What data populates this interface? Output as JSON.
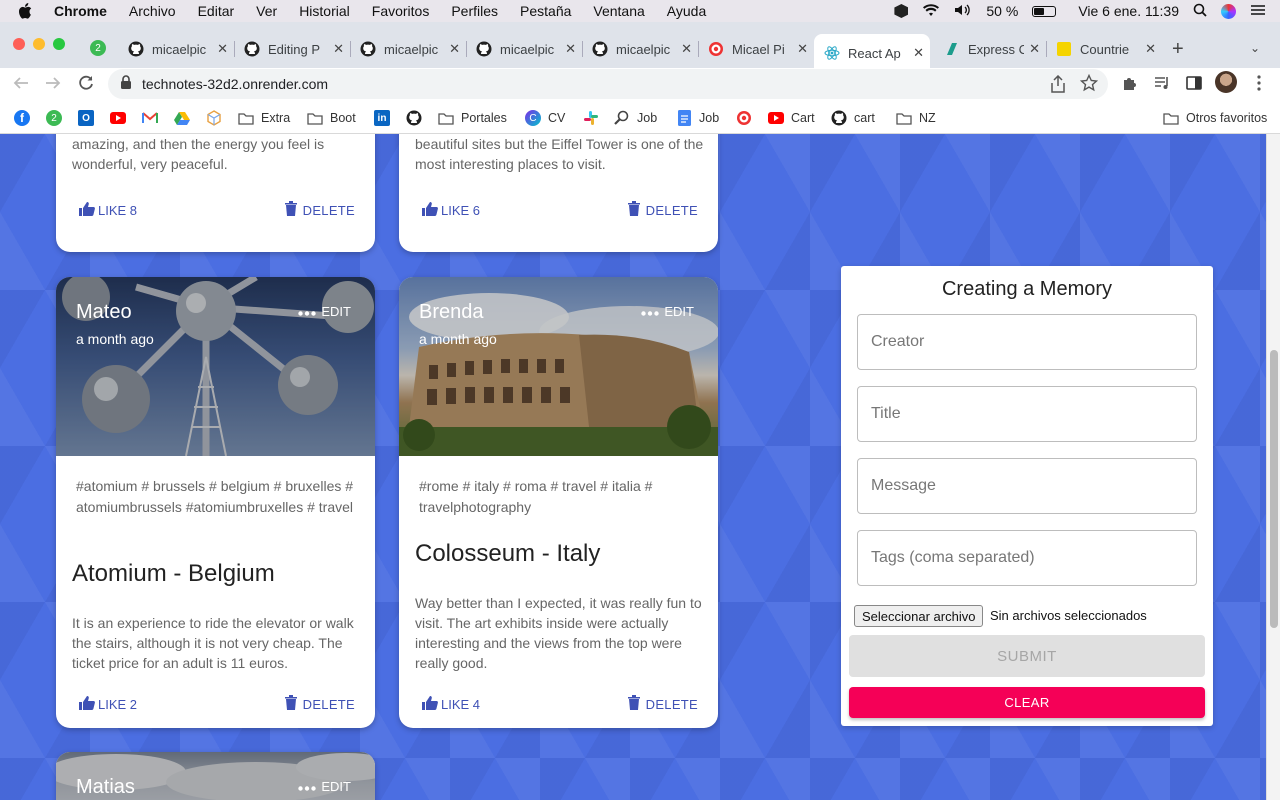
{
  "menubar": {
    "app": "Chrome",
    "items": [
      "Archivo",
      "Editar",
      "Ver",
      "Historial",
      "Favoritos",
      "Perfiles",
      "Pestaña",
      "Ventana",
      "Ayuda"
    ],
    "battery": "50 %",
    "datetime": "Vie 6 ene.  11:39"
  },
  "tabs": [
    {
      "label": "micaelpic",
      "icon": "github-icon"
    },
    {
      "label": "Editing P",
      "icon": "github-icon"
    },
    {
      "label": "micaelpic",
      "icon": "github-icon"
    },
    {
      "label": "micaelpic",
      "icon": "github-icon"
    },
    {
      "label": "micaelpic",
      "icon": "github-icon"
    },
    {
      "label": "Micael Pi",
      "icon": "target-icon"
    },
    {
      "label": "React Ap",
      "icon": "react-icon",
      "active": true
    },
    {
      "label": "Express C",
      "icon": "render-icon"
    },
    {
      "label": "Countrie",
      "icon": "yellow-app-icon"
    }
  ],
  "tab_badge": "2",
  "address": {
    "url": "technotes-32d2.onrender.com"
  },
  "bookmarks": {
    "badge": "2",
    "items": [
      "Extra",
      "Boot",
      "Portales",
      "CV",
      "Job",
      "Job",
      "Cart",
      "cart",
      "NZ"
    ],
    "other": "Otros favoritos"
  },
  "cards": [
    {
      "message": "to the mountain, getting to the place is amazing, and then the energy you feel is wonderful, very peaceful.",
      "likes": "LIKE 8",
      "delete": "DELETE"
    },
    {
      "message": "innumerable museums, parks, restaurants and beautiful sites but the Eiffel Tower is one of the most interesting places to visit.",
      "likes": "LIKE 6",
      "delete": "DELETE"
    },
    {
      "creator": "Mateo",
      "time": "a month ago",
      "edit": "EDIT",
      "tags": "#atomium # brussels # belgium # bruxelles # atomiumbrussels #atomiumbruxelles # travel",
      "title": "Atomium - Belgium",
      "message": "It is an experience to ride the elevator or walk the stairs, although it is not very cheap. The ticket price for an adult is 11 euros.",
      "likes": "LIKE 2",
      "delete": "DELETE"
    },
    {
      "creator": "Brenda",
      "time": "a month ago",
      "edit": "EDIT",
      "tags": "#rome # italy # roma # travel # italia # travelphotography",
      "title": "Colosseum - Italy",
      "message": "Way better than I expected, it was really fun to visit. The art exhibits inside were actually interesting and the views from the top were really good.",
      "likes": "LIKE 4",
      "delete": "DELETE"
    },
    {
      "creator": "Matias",
      "edit": "EDIT"
    }
  ],
  "form": {
    "title": "Creating a Memory",
    "creator_placeholder": "Creator",
    "title_placeholder": "Title",
    "message_placeholder": "Message",
    "tags_placeholder": "Tags (coma separated)",
    "file_button": "Seleccionar archivo",
    "file_status": "Sin archivos seleccionados",
    "submit": "SUBMIT",
    "clear": "CLEAR"
  },
  "colors": {
    "accent": "#3f51b5",
    "clear": "#f50057",
    "background": "#4b6ee2"
  }
}
